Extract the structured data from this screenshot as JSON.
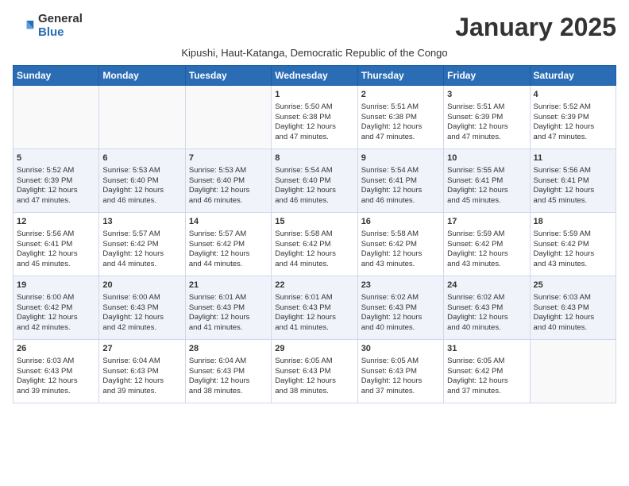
{
  "logo": {
    "general": "General",
    "blue": "Blue"
  },
  "header": {
    "month_year": "January 2025",
    "location": "Kipushi, Haut-Katanga, Democratic Republic of the Congo"
  },
  "weekdays": [
    "Sunday",
    "Monday",
    "Tuesday",
    "Wednesday",
    "Thursday",
    "Friday",
    "Saturday"
  ],
  "weeks": [
    [
      {
        "num": "",
        "content": ""
      },
      {
        "num": "",
        "content": ""
      },
      {
        "num": "",
        "content": ""
      },
      {
        "num": "1",
        "content": "Sunrise: 5:50 AM\nSunset: 6:38 PM\nDaylight: 12 hours\nand 47 minutes."
      },
      {
        "num": "2",
        "content": "Sunrise: 5:51 AM\nSunset: 6:38 PM\nDaylight: 12 hours\nand 47 minutes."
      },
      {
        "num": "3",
        "content": "Sunrise: 5:51 AM\nSunset: 6:39 PM\nDaylight: 12 hours\nand 47 minutes."
      },
      {
        "num": "4",
        "content": "Sunrise: 5:52 AM\nSunset: 6:39 PM\nDaylight: 12 hours\nand 47 minutes."
      }
    ],
    [
      {
        "num": "5",
        "content": "Sunrise: 5:52 AM\nSunset: 6:39 PM\nDaylight: 12 hours\nand 47 minutes."
      },
      {
        "num": "6",
        "content": "Sunrise: 5:53 AM\nSunset: 6:40 PM\nDaylight: 12 hours\nand 46 minutes."
      },
      {
        "num": "7",
        "content": "Sunrise: 5:53 AM\nSunset: 6:40 PM\nDaylight: 12 hours\nand 46 minutes."
      },
      {
        "num": "8",
        "content": "Sunrise: 5:54 AM\nSunset: 6:40 PM\nDaylight: 12 hours\nand 46 minutes."
      },
      {
        "num": "9",
        "content": "Sunrise: 5:54 AM\nSunset: 6:41 PM\nDaylight: 12 hours\nand 46 minutes."
      },
      {
        "num": "10",
        "content": "Sunrise: 5:55 AM\nSunset: 6:41 PM\nDaylight: 12 hours\nand 45 minutes."
      },
      {
        "num": "11",
        "content": "Sunrise: 5:56 AM\nSunset: 6:41 PM\nDaylight: 12 hours\nand 45 minutes."
      }
    ],
    [
      {
        "num": "12",
        "content": "Sunrise: 5:56 AM\nSunset: 6:41 PM\nDaylight: 12 hours\nand 45 minutes."
      },
      {
        "num": "13",
        "content": "Sunrise: 5:57 AM\nSunset: 6:42 PM\nDaylight: 12 hours\nand 44 minutes."
      },
      {
        "num": "14",
        "content": "Sunrise: 5:57 AM\nSunset: 6:42 PM\nDaylight: 12 hours\nand 44 minutes."
      },
      {
        "num": "15",
        "content": "Sunrise: 5:58 AM\nSunset: 6:42 PM\nDaylight: 12 hours\nand 44 minutes."
      },
      {
        "num": "16",
        "content": "Sunrise: 5:58 AM\nSunset: 6:42 PM\nDaylight: 12 hours\nand 43 minutes."
      },
      {
        "num": "17",
        "content": "Sunrise: 5:59 AM\nSunset: 6:42 PM\nDaylight: 12 hours\nand 43 minutes."
      },
      {
        "num": "18",
        "content": "Sunrise: 5:59 AM\nSunset: 6:42 PM\nDaylight: 12 hours\nand 43 minutes."
      }
    ],
    [
      {
        "num": "19",
        "content": "Sunrise: 6:00 AM\nSunset: 6:42 PM\nDaylight: 12 hours\nand 42 minutes."
      },
      {
        "num": "20",
        "content": "Sunrise: 6:00 AM\nSunset: 6:43 PM\nDaylight: 12 hours\nand 42 minutes."
      },
      {
        "num": "21",
        "content": "Sunrise: 6:01 AM\nSunset: 6:43 PM\nDaylight: 12 hours\nand 41 minutes."
      },
      {
        "num": "22",
        "content": "Sunrise: 6:01 AM\nSunset: 6:43 PM\nDaylight: 12 hours\nand 41 minutes."
      },
      {
        "num": "23",
        "content": "Sunrise: 6:02 AM\nSunset: 6:43 PM\nDaylight: 12 hours\nand 40 minutes."
      },
      {
        "num": "24",
        "content": "Sunrise: 6:02 AM\nSunset: 6:43 PM\nDaylight: 12 hours\nand 40 minutes."
      },
      {
        "num": "25",
        "content": "Sunrise: 6:03 AM\nSunset: 6:43 PM\nDaylight: 12 hours\nand 40 minutes."
      }
    ],
    [
      {
        "num": "26",
        "content": "Sunrise: 6:03 AM\nSunset: 6:43 PM\nDaylight: 12 hours\nand 39 minutes."
      },
      {
        "num": "27",
        "content": "Sunrise: 6:04 AM\nSunset: 6:43 PM\nDaylight: 12 hours\nand 39 minutes."
      },
      {
        "num": "28",
        "content": "Sunrise: 6:04 AM\nSunset: 6:43 PM\nDaylight: 12 hours\nand 38 minutes."
      },
      {
        "num": "29",
        "content": "Sunrise: 6:05 AM\nSunset: 6:43 PM\nDaylight: 12 hours\nand 38 minutes."
      },
      {
        "num": "30",
        "content": "Sunrise: 6:05 AM\nSunset: 6:43 PM\nDaylight: 12 hours\nand 37 minutes."
      },
      {
        "num": "31",
        "content": "Sunrise: 6:05 AM\nSunset: 6:42 PM\nDaylight: 12 hours\nand 37 minutes."
      },
      {
        "num": "",
        "content": ""
      }
    ]
  ]
}
